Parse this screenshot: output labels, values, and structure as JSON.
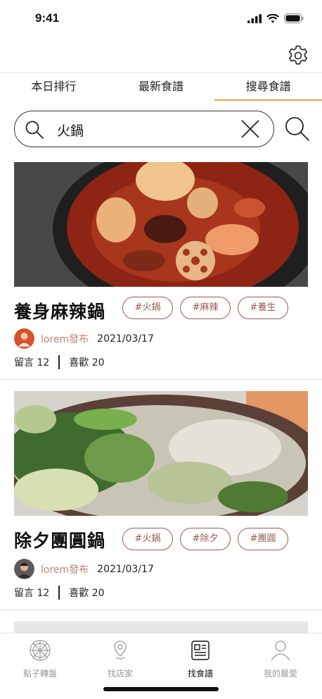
{
  "status_bar": {
    "time": "9:41"
  },
  "tabs": [
    {
      "label": "本日排行",
      "active": false
    },
    {
      "label": "最新食譜",
      "active": false
    },
    {
      "label": "搜尋食譜",
      "active": true
    }
  ],
  "search": {
    "value": "火鍋"
  },
  "recipes": [
    {
      "title": "養身麻辣鍋",
      "tags": [
        "#火鍋",
        "#麻辣",
        "#養生"
      ],
      "author": "lorem發布",
      "date": "2021/03/17",
      "comments": "留言 12",
      "likes": "喜歡 20"
    },
    {
      "title": "除夕團圓鍋",
      "tags": [
        "#火鍋",
        "#除夕",
        "#團圓"
      ],
      "author": "lorem發布",
      "date": "2021/03/17",
      "comments": "留言 12",
      "likes": "喜歡 20"
    }
  ],
  "bottom_nav": [
    {
      "label": "點子轉盤",
      "icon": "wheel-icon",
      "active": false
    },
    {
      "label": "找店家",
      "icon": "map-pin-icon",
      "active": false
    },
    {
      "label": "找食譜",
      "icon": "recipe-book-icon",
      "active": true
    },
    {
      "label": "我的最愛",
      "icon": "user-icon",
      "active": false
    }
  ],
  "colors": {
    "accent": "#e8a33d",
    "tag": "#9b5a4f",
    "author": "#c08374"
  }
}
